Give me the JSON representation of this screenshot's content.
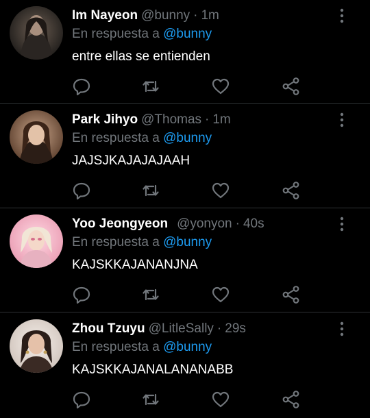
{
  "colors": {
    "background": "#000000",
    "name": "#ffffff",
    "secondary": "#71767b",
    "mention": "#1d9bf0",
    "divider": "#2f3336"
  },
  "tweets": [
    {
      "name": "Im Nayeon",
      "handle": "@bunny",
      "separator": "·",
      "time": "1m",
      "reply_prefix": "En respuesta a",
      "reply_to": "@bunny",
      "text": "entre ellas se entienden"
    },
    {
      "name": "Park Jihyo",
      "handle": "@Thomas",
      "separator": "·",
      "time": "1m",
      "reply_prefix": "En respuesta a",
      "reply_to": "@bunny",
      "text": "JAJSJKAJAJAJAAH"
    },
    {
      "name": "Yoo Jeongyeon",
      "handle": "@yonyon",
      "separator": "·",
      "time": "40s",
      "reply_prefix": "En respuesta a",
      "reply_to": "@bunny",
      "text": "KAJSKKAJANANJNA"
    },
    {
      "name": "Zhou Tzuyu",
      "handle": "@LitleSally",
      "separator": "·",
      "time": "29s",
      "reply_prefix": "En respuesta a",
      "reply_to": "@bunny",
      "text": "KAJSKKAJANALANANABB"
    }
  ],
  "icons": {
    "more": "more-vertical-icon",
    "reply": "reply-icon",
    "retweet": "retweet-icon",
    "like": "heart-icon",
    "share": "share-icon"
  }
}
